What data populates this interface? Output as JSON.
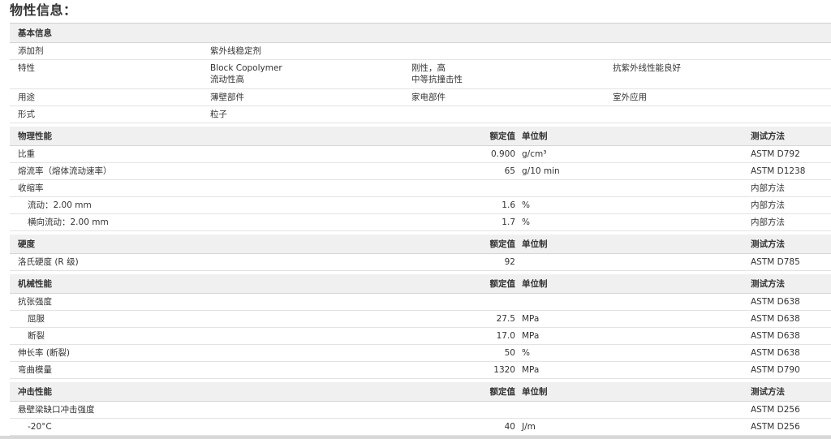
{
  "page_title": "物性信息：",
  "basic": {
    "header": "基本信息",
    "rows": [
      {
        "label": "添加剂",
        "values": [
          "紫外线稳定剂"
        ]
      },
      {
        "label": "特性",
        "values": [
          [
            "Block Copolymer",
            "流动性高"
          ],
          [
            "刚性，高",
            "中等抗撞击性"
          ],
          [
            "抗紫外线性能良好"
          ]
        ]
      },
      {
        "label": "用途",
        "values": [
          "薄壁部件",
          "家电部件",
          "室外应用"
        ]
      },
      {
        "label": "形式",
        "values": [
          "粒子"
        ]
      }
    ]
  },
  "sections": [
    {
      "header": "物理性能",
      "col_value": "额定值",
      "col_unit": "单位制",
      "col_method": "测试方法",
      "rows": [
        {
          "label": "比重",
          "value": "0.900",
          "unit": "g/cm³",
          "method": "ASTM D792",
          "indent": false
        },
        {
          "label": "熔流率（熔体流动速率）",
          "value": "65",
          "unit": "g/10 min",
          "method": "ASTM D1238",
          "indent": false
        },
        {
          "label": "收缩率",
          "value": "",
          "unit": "",
          "method": "内部方法",
          "indent": false
        },
        {
          "label": "流动：2.00 mm",
          "value": "1.6",
          "unit": "%",
          "method": "内部方法",
          "indent": true
        },
        {
          "label": "横向流动：2.00 mm",
          "value": "1.7",
          "unit": "%",
          "method": "内部方法",
          "indent": true
        }
      ]
    },
    {
      "header": "硬度",
      "col_value": "额定值",
      "col_unit": "单位制",
      "col_method": "测试方法",
      "rows": [
        {
          "label": "洛氏硬度 (R 级)",
          "value": "92",
          "unit": "",
          "method": "ASTM D785",
          "indent": false
        }
      ]
    },
    {
      "header": "机械性能",
      "col_value": "额定值",
      "col_unit": "单位制",
      "col_method": "测试方法",
      "rows": [
        {
          "label": "抗张强度",
          "value": "",
          "unit": "",
          "method": "ASTM D638",
          "indent": false
        },
        {
          "label": "屈服",
          "value": "27.5",
          "unit": "MPa",
          "method": "ASTM D638",
          "indent": true
        },
        {
          "label": "断裂",
          "value": "17.0",
          "unit": "MPa",
          "method": "ASTM D638",
          "indent": true
        },
        {
          "label": "伸长率 (断裂)",
          "value": "50",
          "unit": "%",
          "method": "ASTM D638",
          "indent": false
        },
        {
          "label": "弯曲模量",
          "value": "1320",
          "unit": "MPa",
          "method": "ASTM D790",
          "indent": false
        }
      ]
    },
    {
      "header": "冲击性能",
      "col_value": "额定值",
      "col_unit": "单位制",
      "col_method": "测试方法",
      "rows": [
        {
          "label": "悬壁梁缺口冲击强度",
          "value": "",
          "unit": "",
          "method": "ASTM D256",
          "indent": false
        },
        {
          "label": "-20°C",
          "value": "40",
          "unit": "J/m",
          "method": "ASTM D256",
          "indent": true
        }
      ]
    }
  ]
}
